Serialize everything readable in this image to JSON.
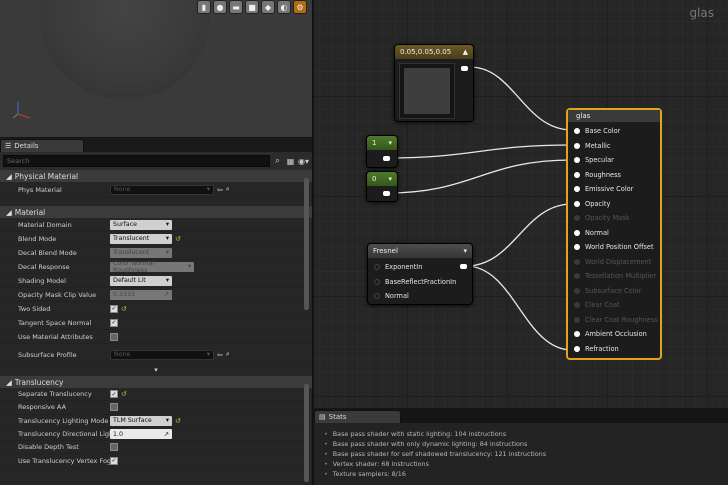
{
  "viewport": {
    "toolbar_icons": [
      "sphere-icon",
      "cube-icon",
      "plane-icon",
      "cylinder-icon",
      "teapot-icon",
      "realtime-icon",
      "settings-icon"
    ]
  },
  "details": {
    "tab_label": "Details",
    "search_placeholder": "Search",
    "categories": {
      "physical_material": "Physical Material",
      "material": "Material",
      "translucency": "Translucency"
    },
    "phys_material": {
      "label": "Phys Material",
      "value": "None"
    },
    "material_rows": [
      {
        "label": "Material Domain",
        "value": "Surface"
      },
      {
        "label": "Blend Mode",
        "value": "Translucent"
      },
      {
        "label": "Decal Blend Mode",
        "value": "Translucent"
      },
      {
        "label": "Decal Response",
        "value": "Color Normal Roughness"
      },
      {
        "label": "Shading Model",
        "value": "Default Lit"
      },
      {
        "label": "Opacity Mask Clip Value",
        "value": "0.3333"
      },
      {
        "label": "Two Sided",
        "value": ""
      },
      {
        "label": "Tangent Space Normal",
        "value": ""
      },
      {
        "label": "Use Material Attributes",
        "value": ""
      },
      {
        "label": "Subsurface Profile",
        "value": "None"
      }
    ],
    "translucency_rows": [
      {
        "label": "Separate Translucency",
        "value": ""
      },
      {
        "label": "Responsive AA",
        "value": ""
      },
      {
        "label": "Translucency Lighting Mode",
        "value": "TLM Surface"
      },
      {
        "label": "Translucency Directional Lighti",
        "value": "1.0"
      },
      {
        "label": "Disable Depth Test",
        "value": ""
      },
      {
        "label": "Use Translucency Vertex Fog",
        "value": ""
      }
    ]
  },
  "graph": {
    "title": "glas",
    "vector_node": {
      "title": "0.05,0.05,0.05"
    },
    "const1": {
      "title": "1"
    },
    "const0": {
      "title": "0"
    },
    "fresnel": {
      "title": "Fresnel",
      "pins": [
        "ExponentIn",
        "BaseReflectFractionIn",
        "Normal"
      ]
    },
    "main_node": {
      "title": "glas",
      "pins": [
        {
          "label": "Base Color",
          "active": true
        },
        {
          "label": "Metallic",
          "active": true
        },
        {
          "label": "Specular",
          "active": true
        },
        {
          "label": "Roughness",
          "active": true
        },
        {
          "label": "Emissive Color",
          "active": true
        },
        {
          "label": "Opacity",
          "active": true
        },
        {
          "label": "Opacity Mask",
          "active": false
        },
        {
          "label": "Normal",
          "active": true
        },
        {
          "label": "World Position Offset",
          "active": true
        },
        {
          "label": "World Displacement",
          "active": false
        },
        {
          "label": "Tessellation Multiplier",
          "active": false
        },
        {
          "label": "Subsurface Color",
          "active": false
        },
        {
          "label": "Clear Coat",
          "active": false
        },
        {
          "label": "Clear Coat Roughness",
          "active": false
        },
        {
          "label": "Ambient Occlusion",
          "active": true
        },
        {
          "label": "Refraction",
          "active": true
        }
      ]
    }
  },
  "stats": {
    "tab_label": "Stats",
    "lines": [
      "Base pass shader with static lighting: 104 instructions",
      "Base pass shader with only dynamic lighting: 84 instructions",
      "Base pass shader for self shadowed translucency: 121 instructions",
      "Vertex shader: 68 instructions",
      "Texture samplers: 8/16"
    ]
  },
  "colors": {
    "accent": "#e2a418",
    "vector_header": "#5a4c1e",
    "const_header": "#44692a"
  }
}
